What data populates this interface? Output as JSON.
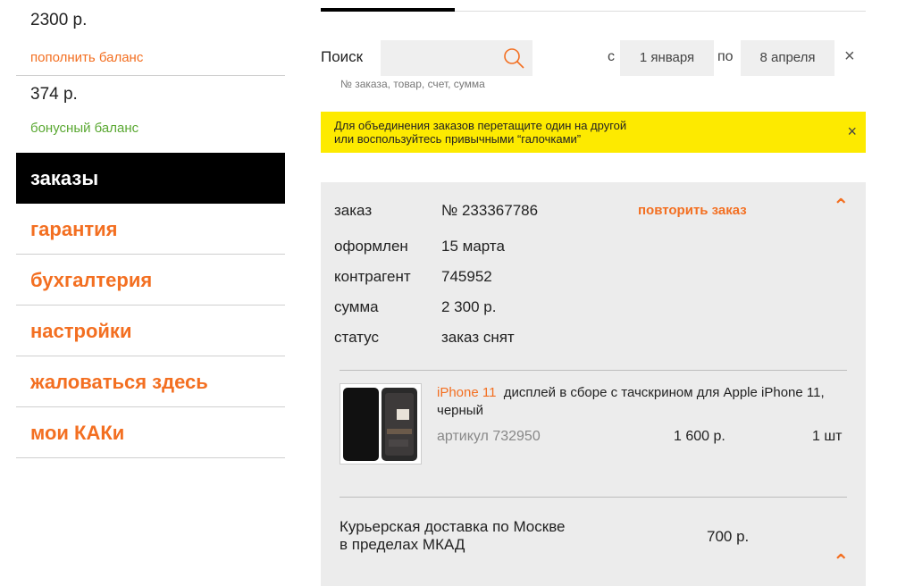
{
  "sidebar": {
    "balance": {
      "value": "2300 р.",
      "link": "пополнить баланс"
    },
    "bonus": {
      "value": "374 р.",
      "label": "бонусный баланс"
    },
    "nav": [
      {
        "label": "заказы",
        "active": true
      },
      {
        "label": "гарантия",
        "active": false
      },
      {
        "label": "бухгалтерия",
        "active": false
      },
      {
        "label": "настройки",
        "active": false
      },
      {
        "label": "жаловаться здесь",
        "active": false
      },
      {
        "label": "мои КАКи",
        "active": false
      }
    ]
  },
  "filters": {
    "search_label": "Поиск",
    "search_value": "",
    "search_hint": "№ заказа, товар, счет, сумма",
    "from_prefix": "с",
    "from_date": "1 января",
    "to_prefix": "по",
    "to_date": "8 апреля",
    "clear": "×"
  },
  "notice": {
    "line1": "Для объединения заказов перетащите один на другой",
    "line2": "или воспользуйтесь привычными “галочками”",
    "close": "×"
  },
  "order": {
    "label_order": "заказ",
    "number": "№ 233367786",
    "repeat_link": "повторить заказ",
    "rows": [
      {
        "label": "оформлен",
        "value": "15 марта"
      },
      {
        "label": "контрагент",
        "value": "745952"
      },
      {
        "label": "сумма",
        "value": "2 300 р."
      },
      {
        "label": "статус",
        "value": "заказ снят"
      }
    ],
    "item": {
      "brand": "iPhone 11",
      "name": "дисплей в сборе с тачскрином для Apple iPhone 11, черный",
      "sku": "артикул 732950",
      "price": "1 600 р.",
      "qty": "1 шт"
    },
    "delivery": {
      "line1": "Курьерская доставка по Москве",
      "line2": "в пределах МКАД",
      "price": "700 р."
    }
  },
  "colors": {
    "accent": "#f36f21",
    "bonus": "#5aa832",
    "notice": "#fdea00",
    "card": "#ececec"
  }
}
